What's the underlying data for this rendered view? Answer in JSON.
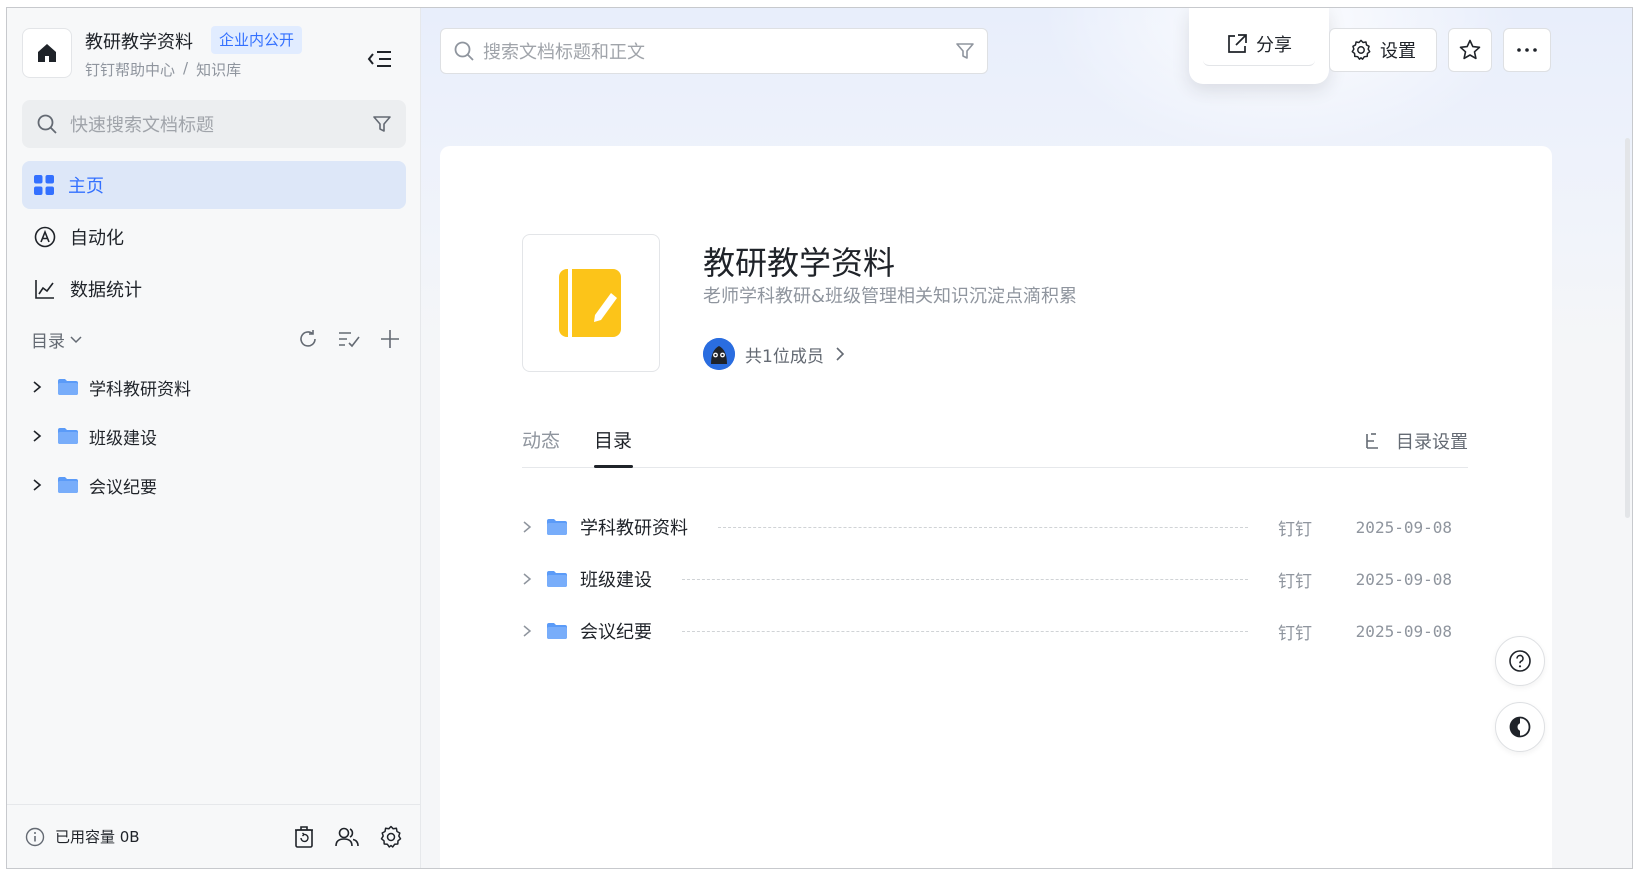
{
  "colors": {
    "accent": "#3370ff",
    "folder": "#5b9bf8",
    "cover_icon": "#fcc419"
  },
  "sidebar": {
    "space_title": "教研教学资料",
    "badge": "企业内公开",
    "breadcrumb": [
      "钉钉帮助中心",
      "/",
      "知识库"
    ],
    "search_placeholder": "快速搜索文档标题",
    "nav": [
      {
        "label": "主页",
        "icon": "grid-icon",
        "active": true
      },
      {
        "label": "自动化",
        "icon": "automation-icon",
        "active": false
      },
      {
        "label": "数据统计",
        "icon": "chart-icon",
        "active": false
      }
    ],
    "directory_label": "目录",
    "tree": [
      {
        "label": "学科教研资料"
      },
      {
        "label": "班级建设"
      },
      {
        "label": "会议纪要"
      }
    ],
    "footer": {
      "usage": "已用容量 0B"
    }
  },
  "header": {
    "search_placeholder": "搜索文档标题和正文",
    "share": "分享",
    "settings": "设置"
  },
  "knowledge_base": {
    "title": "教研教学资料",
    "description": "老师学科教研&班级管理相关知识沉淀点滴积累",
    "members": "共1位成员"
  },
  "tabs": [
    {
      "label": "动态",
      "active": false
    },
    {
      "label": "目录",
      "active": true
    }
  ],
  "directory_settings": "目录设置",
  "rows": [
    {
      "name": "学科教研资料",
      "owner": "钉钉",
      "date": "2025-09-08"
    },
    {
      "name": "班级建设",
      "owner": "钉钉",
      "date": "2025-09-08"
    },
    {
      "name": "会议纪要",
      "owner": "钉钉",
      "date": "2025-09-08"
    }
  ]
}
